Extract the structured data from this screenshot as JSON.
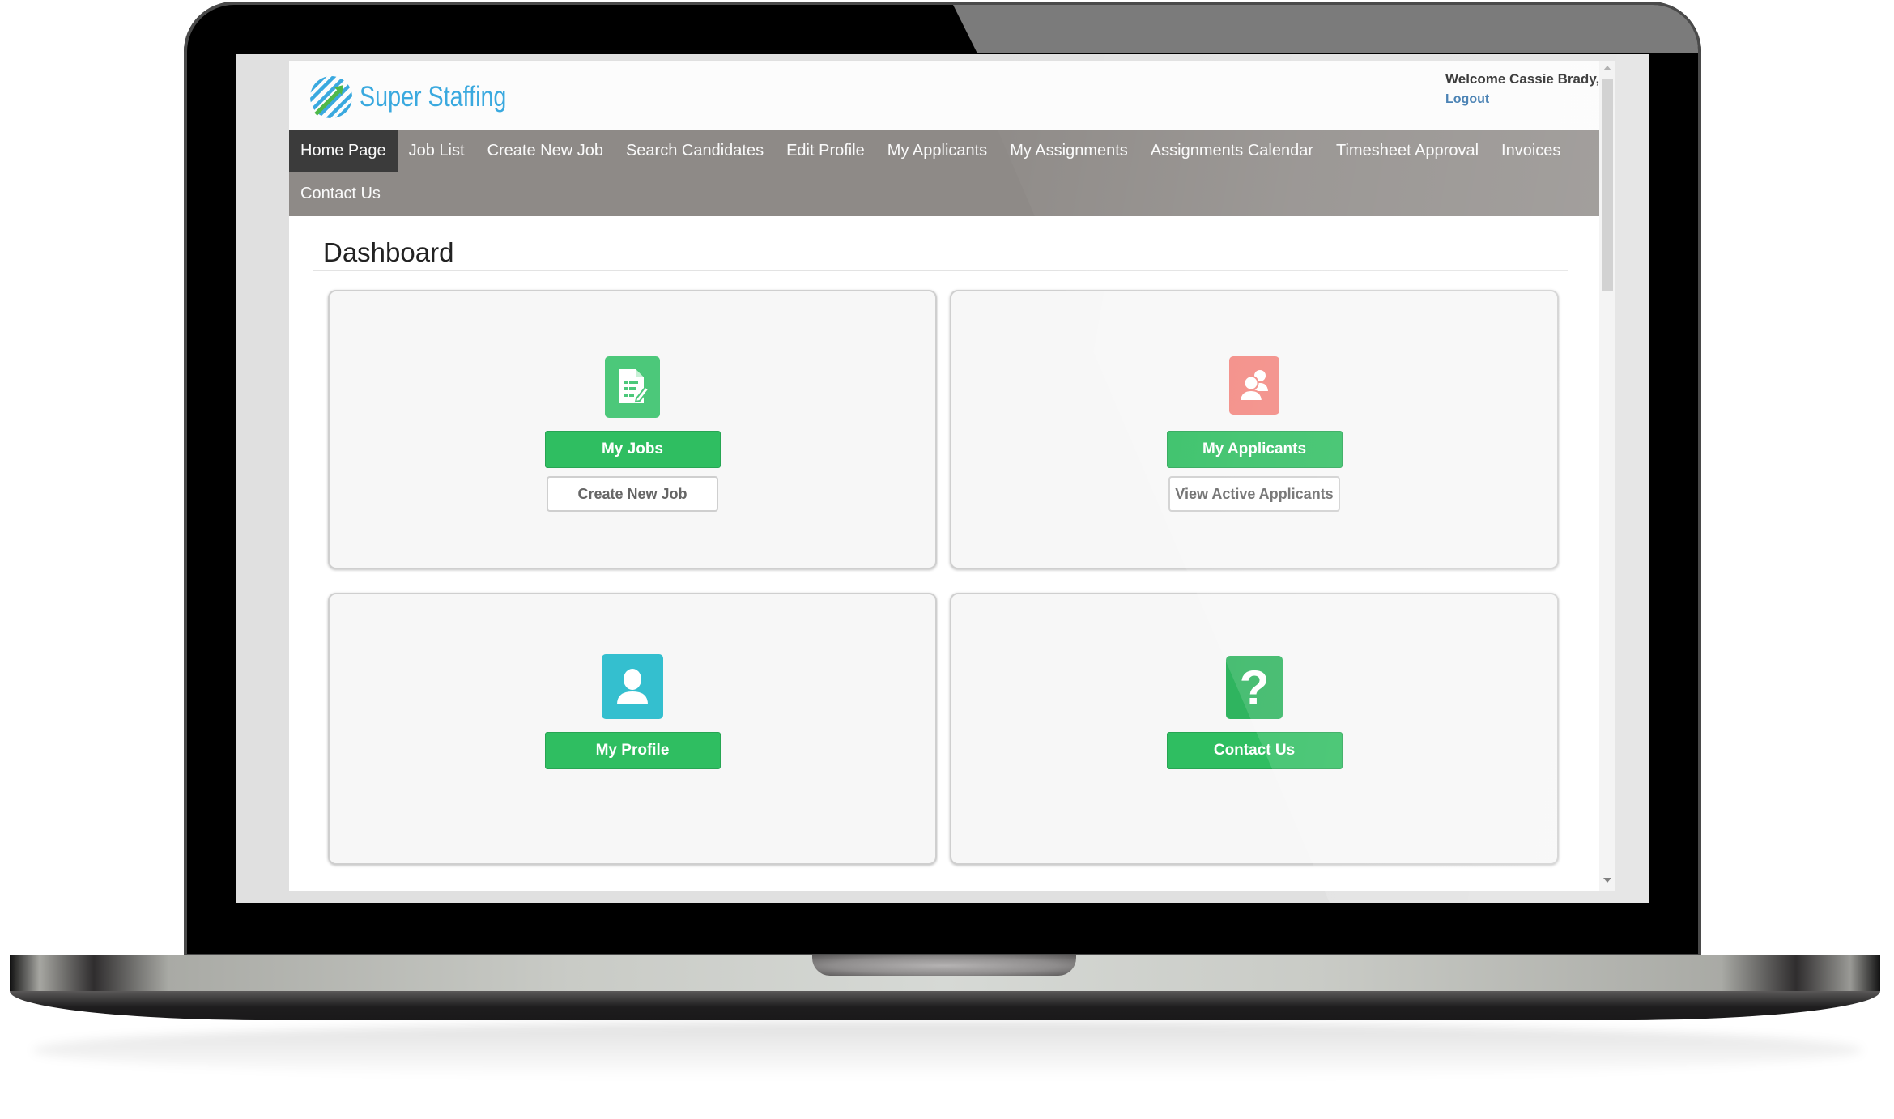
{
  "header": {
    "brand": "Super Staffing",
    "welcome": "Welcome Cassie Brady,",
    "logout": "Logout"
  },
  "nav": {
    "items": [
      {
        "label": "Home Page",
        "active": true
      },
      {
        "label": "Job List"
      },
      {
        "label": "Create New Job"
      },
      {
        "label": "Search Candidates"
      },
      {
        "label": "Edit Profile"
      },
      {
        "label": "My Applicants"
      },
      {
        "label": "My Assignments"
      },
      {
        "label": "Assignments Calendar"
      },
      {
        "label": "Timesheet Approval"
      },
      {
        "label": "Invoices"
      },
      {
        "label": "Contact Us"
      }
    ]
  },
  "dashboard": {
    "title": "Dashboard",
    "cards": [
      {
        "icon": "job-document-edit-icon",
        "icon_color": "#4cc87a",
        "primary": "My Jobs",
        "secondary": "Create New Job"
      },
      {
        "icon": "applicants-users-icon",
        "icon_color": "#f38780",
        "primary": "My Applicants",
        "secondary": "View Active Applicants"
      },
      {
        "icon": "profile-user-icon",
        "icon_color": "#34bfcf",
        "primary": "My Profile"
      },
      {
        "icon": "question-help-icon",
        "icon_color": "#2fb45f",
        "primary": "Contact Us",
        "glyph": "?"
      }
    ]
  },
  "colors": {
    "brand": "#3aa9df",
    "nav_bg": "#8e8a87",
    "nav_active": "#3b3b3b",
    "primary_button": "#2fbe61",
    "link": "#2d6ea8"
  }
}
